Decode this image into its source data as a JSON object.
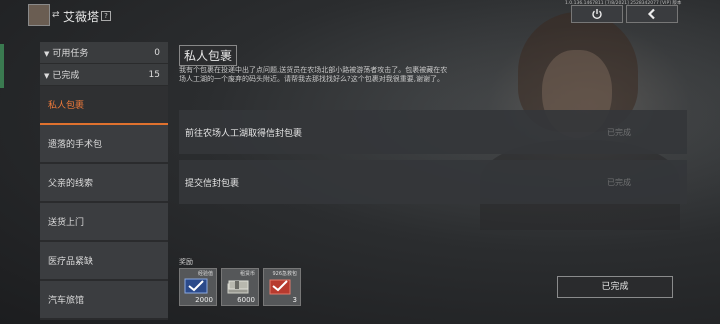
{
  "header": {
    "swap_icon": "⇄",
    "character_name": "艾薇塔",
    "help_icon": "?",
    "version_text": "1.0.136.1467811 [7/8/2021] 2528342077 [VIP] 版本",
    "power_icon": "power-icon",
    "back_icon": "chevron-left-icon"
  },
  "quest_list": {
    "categories": [
      {
        "label": "可用任务",
        "count": "0",
        "chevron": "▼"
      },
      {
        "label": "已完成",
        "count": "15",
        "chevron": "▼"
      }
    ],
    "items": [
      {
        "label": "私人包裹",
        "active": true
      },
      {
        "label": "遗落的手术包"
      },
      {
        "label": "父亲的线索"
      },
      {
        "label": "送货上门"
      },
      {
        "label": "医疗品紧缺"
      },
      {
        "label": "汽车旅馆"
      }
    ]
  },
  "detail": {
    "title": "私人包裹",
    "description": "我有个包裹在投递中出了点问题,送货员在农场北部小路被游荡者攻击了。包裹被藏在农场人工湖的一个废弃的码头附近。请帮我去那找找好么?这个包裹对我很重要,谢谢了。",
    "objectives": [
      {
        "text": "前往农场人工湖取得信封包裹",
        "status": "已完成"
      },
      {
        "text": "提交信封包裹",
        "status": "已完成"
      }
    ],
    "rewards_label": "奖励",
    "rewards": [
      {
        "name": "经验值",
        "count": "2000",
        "icon": "experience-icon"
      },
      {
        "name": "租赁币",
        "count": "6000",
        "icon": "cash-icon"
      },
      {
        "name": "926急救包",
        "count": "3",
        "icon": "medkit-icon"
      }
    ],
    "complete_button": "已完成"
  },
  "colors": {
    "accent": "#e0712e",
    "panel": "#3b3d40",
    "side_tab": "#3a7a50"
  }
}
